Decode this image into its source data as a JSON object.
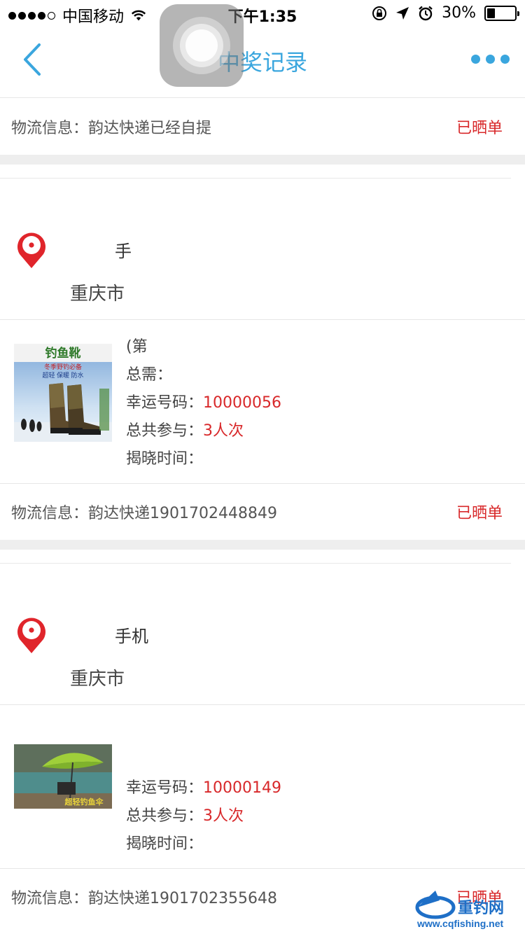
{
  "status_bar": {
    "carrier": "中国移动",
    "time": "下午1:35",
    "battery_percent": "30%",
    "battery_level": 0.3
  },
  "nav": {
    "title": "中奖记录",
    "back_icon": "chevron-left-icon",
    "more_icon": "more-horizontal-icon",
    "accent_color": "#3aa6de"
  },
  "first_logistics": {
    "label": "物流信息：",
    "value": "韵达快递已经自提",
    "status": "已晒单"
  },
  "orders": [
    {
      "address": {
        "name": "手",
        "city": "重庆市"
      },
      "product": {
        "title_prefix": "(第",
        "total_label": "总需：",
        "lucky_label": "幸运号码：",
        "lucky_value": "10000056",
        "joined_label": "总共参与：",
        "joined_value": "3人次",
        "reveal_label": "揭晓时间："
      },
      "logistics": {
        "label": "物流信息：",
        "value": "韵达快递1901702448849",
        "status": "已晒单"
      }
    },
    {
      "address": {
        "name": "手机",
        "city": "重庆市"
      },
      "product": {
        "lucky_label": "幸运号码：",
        "lucky_value": "10000149",
        "joined_label": "总共参与：",
        "joined_value": "3人次",
        "reveal_label": "揭晓时间："
      },
      "logistics": {
        "label": "物流信息：",
        "value": "韵达快递1901702355648",
        "status": "已晒单"
      }
    }
  ],
  "thumbnails": {
    "boots_banner": "钓鱼靴",
    "boots_subtitle": "冬季野钓必备",
    "boots_features": "超轻 保暖 防水",
    "umbrella_banner": "超轻钓鱼伞"
  },
  "watermark": {
    "name": "重钓网",
    "url": "www.cqfishing.net"
  },
  "colors": {
    "status_red": "#d8282a",
    "pin_red": "#e0252b",
    "divider_gray": "#eeeeee"
  }
}
